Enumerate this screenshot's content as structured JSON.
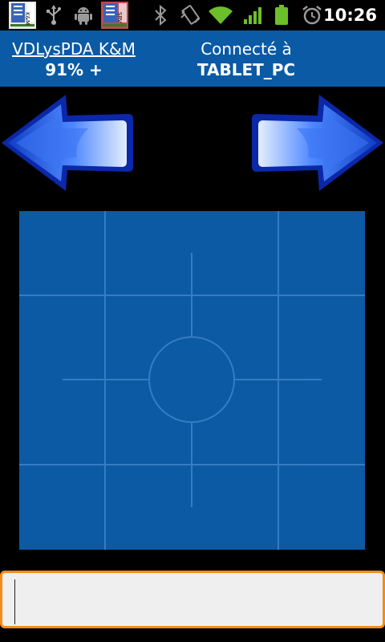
{
  "status_bar": {
    "time": "10:26",
    "icons": [
      "kmvm-app-icon",
      "usb-icon",
      "android-debug-icon",
      "srv-app-icon",
      "bluetooth-icon",
      "vibrate-icon",
      "wifi-icon",
      "signal-icon",
      "battery-icon",
      "alarm-icon"
    ]
  },
  "header": {
    "app_name": "VDLysPDA K&M",
    "battery": "91% +",
    "connected_label": "Connecté à",
    "connected_target": "TABLET_PC"
  },
  "controls": {
    "left_arrow": "arrow-left-icon",
    "right_arrow": "arrow-right-icon"
  },
  "touchpad": {
    "color": "#0c5aa3"
  },
  "input": {
    "value": "",
    "placeholder": ""
  },
  "colors": {
    "header_bg": "#0a5aa5",
    "accent_border": "#f28c1a",
    "arrow_blue": "#1a5ee0"
  }
}
